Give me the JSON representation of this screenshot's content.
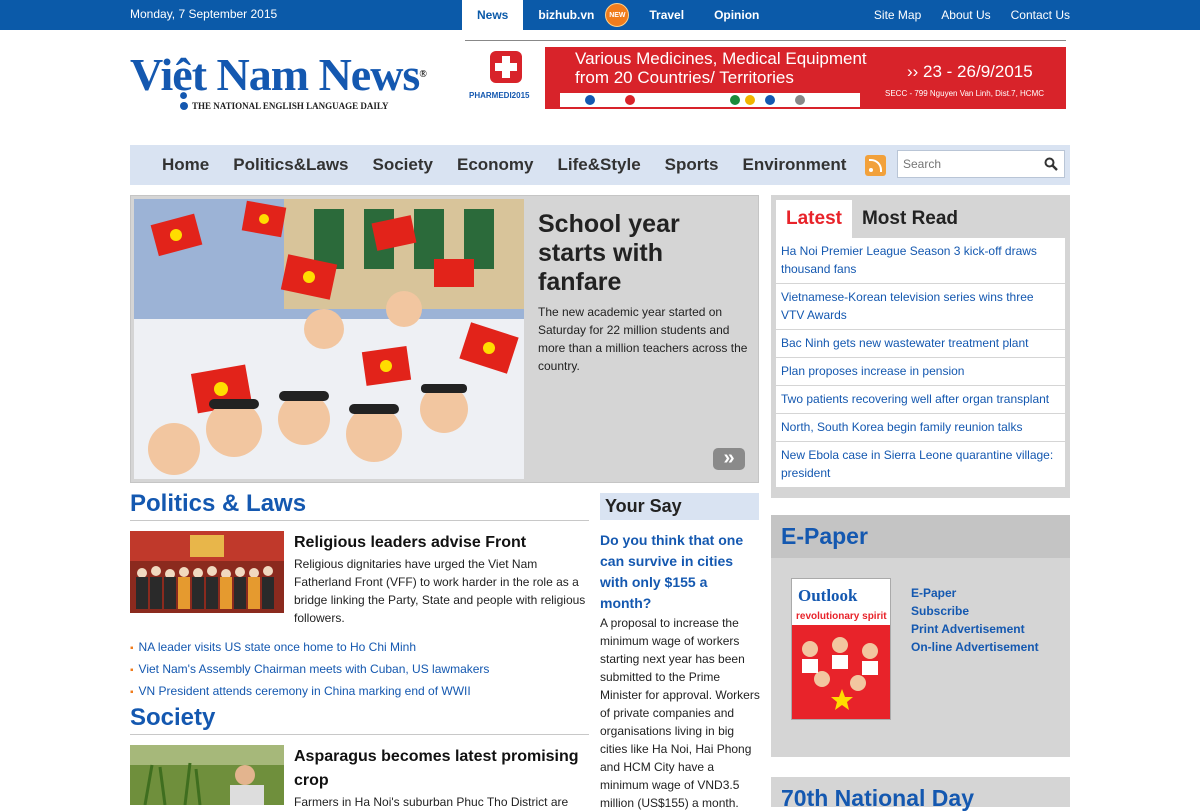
{
  "topbar": {
    "date": "Monday, 7 September 2015",
    "nav": [
      {
        "label": "News"
      },
      {
        "label": "bizhub.vn",
        "badge": "NEW"
      },
      {
        "label": "Travel"
      },
      {
        "label": "Opinion"
      }
    ],
    "links": [
      "Site Map",
      "About Us",
      "Contact Us"
    ]
  },
  "logo": {
    "name": "Việt Nam News",
    "reg": "®",
    "tagline": "THE NATIONAL ENGLISH LANGUAGE DAILY"
  },
  "ad": {
    "brand": "PHARMEDI2015",
    "line1": "Various Medicines, Medical Equipment",
    "line2": "from 20 Countries/ Territories",
    "dates": "›› 23 - 26/9/2015",
    "venue": "SECC - 799 Nguyen Van Linh, Dist.7, HCMC"
  },
  "mainnav": {
    "items": [
      "Home",
      "Politics&Laws",
      "Society",
      "Economy",
      "Life&Style",
      "Sports",
      "Environment"
    ],
    "search_placeholder": "Search",
    "icons": {
      "rss": "rss-icon",
      "search": "search-icon"
    }
  },
  "featured": {
    "title": "School year starts with fanfare",
    "description": "The new academic year started on Saturday for 22 million students and more than a million teachers across the country.",
    "next_label": "»"
  },
  "latest": {
    "tabs": [
      "Latest",
      "Most Read"
    ],
    "items": [
      "Ha Noi Premier League Season 3 kick-off draws thousand fans",
      "Vietnamese-Korean television series wins three VTV Awards",
      "Bac Ninh gets new wastewater treatment plant",
      "Plan proposes increase in pension",
      "Two patients recovering well after organ transplant",
      "North, South Korea begin family reunion talks",
      "New Ebola case in Sierra Leone quarantine village: president"
    ]
  },
  "politics": {
    "heading": "Politics & Laws",
    "story_title": "Religious leaders advise Front",
    "story_desc": "Religious dignitaries have urged the Viet Nam Fatherland Front (VFF) to work harder in the role as a bridge linking the Party, State and people with religious followers.",
    "related": [
      "NA leader visits US state once home to Ho Chi Minh",
      "Viet Nam's Assembly Chairman meets with Cuban, US lawmakers",
      "VN President attends ceremony in China marking end of WWII"
    ]
  },
  "society": {
    "heading": "Society",
    "story_title": "Asparagus becomes latest promising crop",
    "story_desc": "Farmers in Ha Noi's suburban Phuc Tho District are"
  },
  "yoursay": {
    "heading": "Your Say",
    "question": "Do you think that one can survive in cities with only $155 a month?",
    "body": "A proposal to increase the minimum wage of workers starting next year has been submitted to the Prime Minister for approval. Workers of private companies and organisations living in big cities like Ha Noi, Hai Phong and HCM City have a minimum wage of VND3.5 million (US$155) a month."
  },
  "epaper": {
    "heading": "E-Paper",
    "cover_title": "Outlook",
    "cover_headline": "revolutionary spirit",
    "links": [
      "E-Paper",
      "Subscribe",
      "Print Advertisement",
      "On-line Advertisement"
    ]
  },
  "nationalday": {
    "heading": "70th National Day"
  },
  "colors": {
    "brand_blue": "#0b5aa9",
    "link_blue": "#1458b0",
    "accent_red": "#e8232a",
    "nav_bg": "#d9e3f2"
  }
}
